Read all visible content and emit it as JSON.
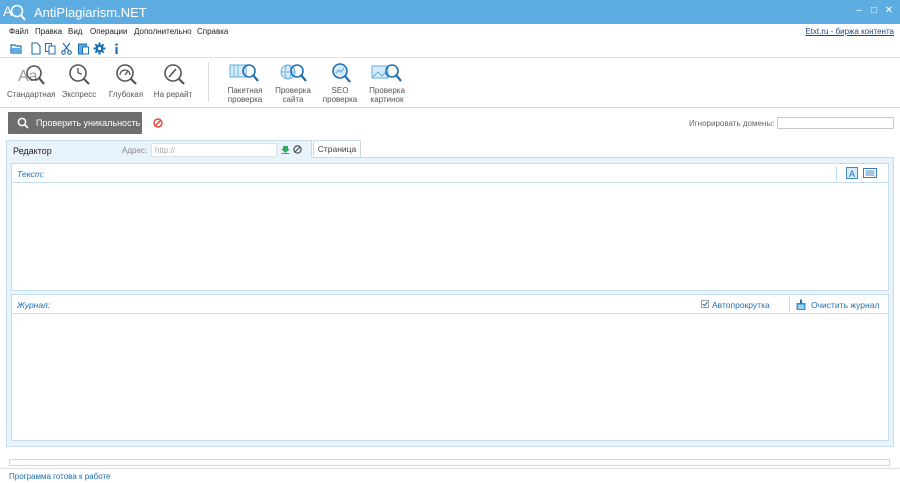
{
  "app": {
    "title": "AntiPlagiarism.NET"
  },
  "window_buttons": {
    "minimize": "–",
    "maximize": "□",
    "close": "✕"
  },
  "menu": {
    "items": [
      "Файл",
      "Правка",
      "Вид",
      "Операции",
      "Дополнительно",
      "Справка"
    ],
    "link": "Etxt.ru - биржа контента"
  },
  "ribbon": {
    "modes": [
      {
        "label": "Стандартная",
        "icon": "aa-search-icon"
      },
      {
        "label": "Экспресс",
        "icon": "clock-icon"
      },
      {
        "label": "Глубокая",
        "icon": "gauge-icon"
      },
      {
        "label": "На рерайт",
        "icon": "pen-search-icon"
      }
    ],
    "checks": [
      {
        "line1": "Пакетная",
        "line2": "проверка",
        "icon": "batch-search-icon"
      },
      {
        "line1": "Проверка",
        "line2": "сайта",
        "icon": "globe-search-icon"
      },
      {
        "line1": "SEO",
        "line2": "проверка",
        "icon": "seo-search-icon"
      },
      {
        "line1": "Проверка",
        "line2": "картинок",
        "icon": "image-search-icon"
      }
    ]
  },
  "toolbar": {
    "check_button": "Проверить уникальность",
    "ignore_domains_label": "Игнорировать домены:",
    "ignore_domains_value": ""
  },
  "tabs": {
    "editor": "Редактор",
    "address_label": "Адрес:",
    "address_placeholder": "http://",
    "page": "Страница"
  },
  "text_panel": {
    "label": "Текст:"
  },
  "journal": {
    "label": "Журнал:",
    "autoscroll": "Автопрокрутка",
    "autoscroll_checked": true,
    "clear": "Очистить журнал"
  },
  "status": {
    "progress": 0,
    "text": "Программа готова к работе"
  },
  "colors": {
    "titlebar": "#5dade2",
    "accent_text": "#1f6fb5",
    "panel_bg": "#e9f3fb",
    "button_bg": "#6e6e6e"
  }
}
